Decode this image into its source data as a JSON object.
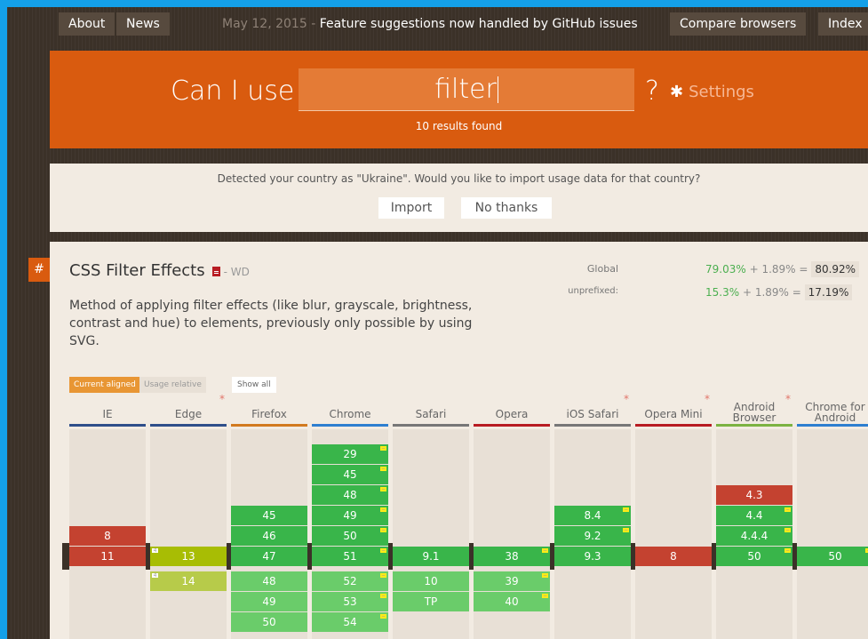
{
  "nav": {
    "about": "About",
    "news": "News",
    "announcement_date": "May 12, 2015 -",
    "announcement_text": "Feature suggestions now handled by GitHub issues",
    "compare": "Compare browsers",
    "index": "Index"
  },
  "search": {
    "label": "Can I use",
    "value": "filter",
    "question": "?",
    "settings_label": "Settings",
    "settings_icon": "gear-icon",
    "results": "10 results found"
  },
  "country": {
    "message": "Detected your country as \"Ukraine\". Would you like to import usage data for that country?",
    "import_label": "Import",
    "decline_label": "No thanks"
  },
  "feature": {
    "hash": "#",
    "title": "CSS Filter Effects",
    "doc_icon": "document-icon",
    "status": "- WD",
    "description": "Method of applying filter effects (like blur, grayscale, brightness, contrast and hue) to elements, previously only possible by using SVG.",
    "stats": {
      "global_label": "Global",
      "global_full": "79.03%",
      "global_partial": "+ 1.89%",
      "global_eq": "=",
      "global_total": "80.92%",
      "unprefixed_label": "unprefixed:",
      "unprefixed_full": "15.3%",
      "unprefixed_partial": "+ 1.89%",
      "unprefixed_eq": "=",
      "unprefixed_total": "17.19%"
    }
  },
  "tabs": {
    "current": "Current aligned",
    "relative": "Usage relative",
    "show_all": "Show all"
  },
  "colors": {
    "supported": "#39b54a",
    "supported_light": "#6acc6a",
    "partial": "#a8bd04",
    "partial_light": "#b7cb4a",
    "unsupported": "#c44230",
    "accent": "#d95b0f"
  },
  "browsers": [
    {
      "name": "IE",
      "star": "",
      "bar": "#2f4f8a",
      "cells": [
        {
          "v": "8",
          "s": "n"
        },
        {
          "v": "11",
          "s": "n",
          "cur": true
        }
      ]
    },
    {
      "name": "Edge",
      "star": "*",
      "bar": "#2f4f8a",
      "cells": [
        {
          "v": "13",
          "s": "a",
          "cur": true,
          "flag": "4"
        },
        {
          "v": "14",
          "s": "a2",
          "flag": "4"
        }
      ]
    },
    {
      "name": "Firefox",
      "star": "",
      "bar": "#d27a1f",
      "cells": [
        {
          "v": "45",
          "s": "y"
        },
        {
          "v": "46",
          "s": "y"
        },
        {
          "v": "47",
          "s": "y",
          "cur": true
        },
        {
          "v": "48",
          "s": "y2"
        },
        {
          "v": "49",
          "s": "y2"
        },
        {
          "v": "50",
          "s": "y2"
        }
      ]
    },
    {
      "name": "Chrome",
      "star": "",
      "bar": "#2e7fd0",
      "cells": [
        {
          "v": "29",
          "s": "y",
          "flag": "-"
        },
        {
          "v": "45",
          "s": "y",
          "flag": "-"
        },
        {
          "v": "48",
          "s": "y",
          "flag": "-"
        },
        {
          "v": "49",
          "s": "y",
          "flag": "-"
        },
        {
          "v": "50",
          "s": "y",
          "flag": "-"
        },
        {
          "v": "51",
          "s": "y",
          "cur": true,
          "flag": "-"
        },
        {
          "v": "52",
          "s": "y2",
          "flag": "-"
        },
        {
          "v": "53",
          "s": "y2",
          "flag": "-"
        },
        {
          "v": "54",
          "s": "y2",
          "flag": "-"
        }
      ]
    },
    {
      "name": "Safari",
      "star": "",
      "bar": "#777777",
      "cells": [
        {
          "v": "9.1",
          "s": "y",
          "cur": true
        },
        {
          "v": "10",
          "s": "y2"
        },
        {
          "v": "TP",
          "s": "y2"
        }
      ]
    },
    {
      "name": "Opera",
      "star": "",
      "bar": "#b81c23",
      "cells": [
        {
          "v": "38",
          "s": "y",
          "cur": true,
          "flag": "-"
        },
        {
          "v": "39",
          "s": "y2",
          "flag": "-"
        },
        {
          "v": "40",
          "s": "y2",
          "flag": "-"
        }
      ]
    },
    {
      "name": "iOS Safari",
      "star": "*",
      "bar": "#777777",
      "cells": [
        {
          "v": "8.4",
          "s": "y",
          "flag": "-"
        },
        {
          "v": "9.2",
          "s": "y",
          "flag": "-"
        },
        {
          "v": "9.3",
          "s": "y",
          "cur": true
        }
      ]
    },
    {
      "name": "Opera Mini",
      "star": "*",
      "bar": "#b81c23",
      "cells": [
        {
          "v": "8",
          "s": "n",
          "cur": true
        }
      ]
    },
    {
      "name": "Android Browser",
      "star": "*",
      "bar": "#7cb342",
      "cells": [
        {
          "v": "4.3",
          "s": "n"
        },
        {
          "v": "4.4",
          "s": "y",
          "flag": "-"
        },
        {
          "v": "4.4.4",
          "s": "y",
          "flag": "-"
        },
        {
          "v": "50",
          "s": "y",
          "cur": true,
          "flag": "-"
        }
      ]
    },
    {
      "name": "Chrome for Android",
      "star": "",
      "bar": "#2e7fd0",
      "cells": [
        {
          "v": "50",
          "s": "y",
          "cur": true,
          "flag": "-"
        }
      ]
    }
  ]
}
